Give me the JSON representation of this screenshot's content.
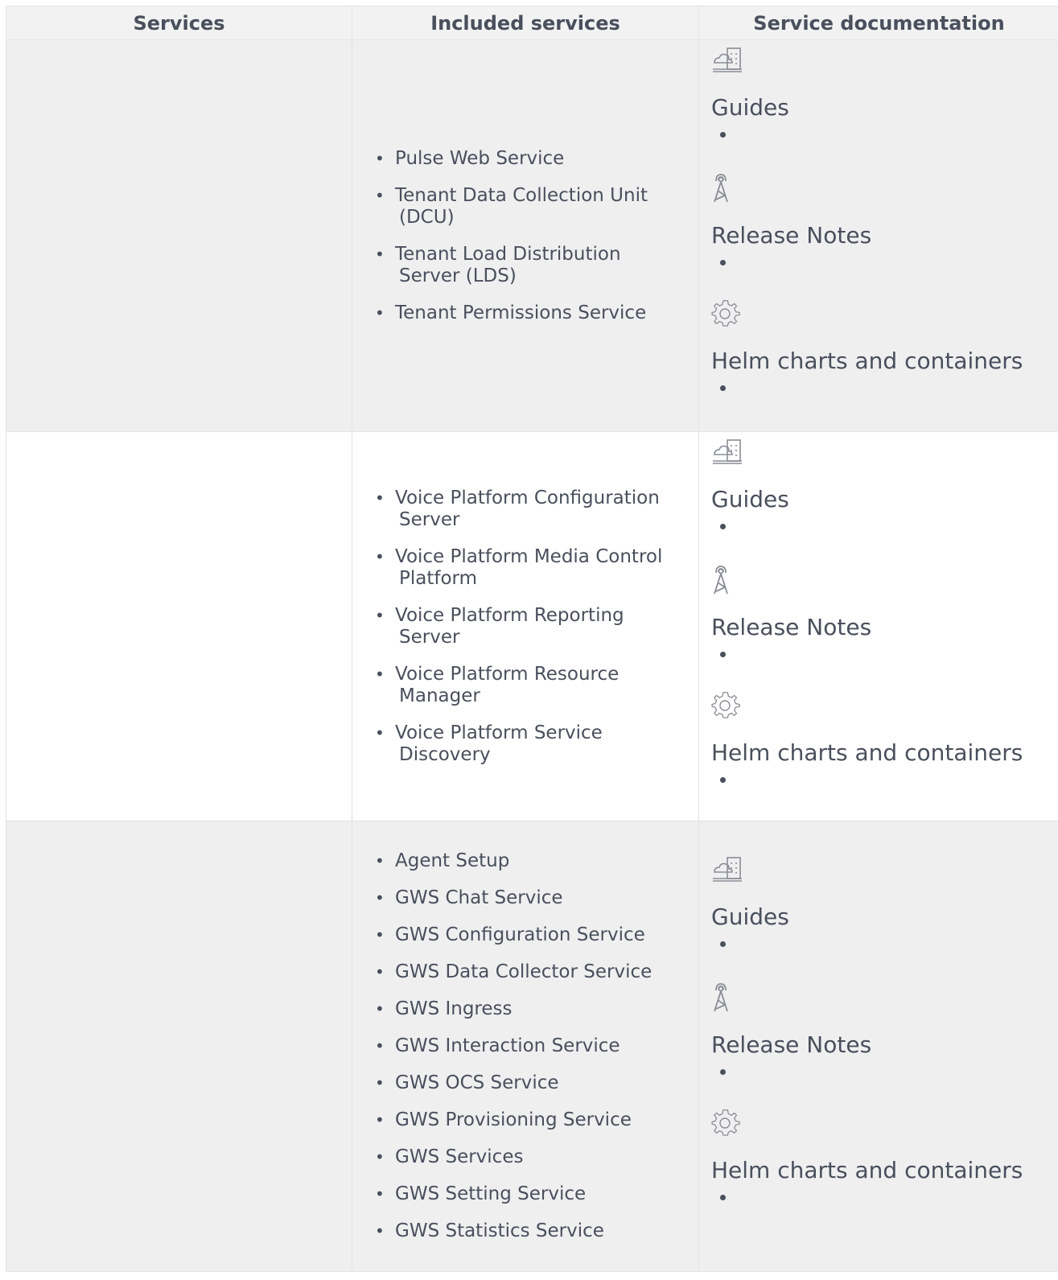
{
  "table": {
    "headers": [
      "Services",
      "Included services",
      "Service documentation"
    ],
    "rows": [
      {
        "services": "",
        "included": [
          "Pulse Web Service",
          "Tenant Data Collection Unit\n(DCU)",
          "Tenant Load Distribution\nServer (LDS)",
          "Tenant Permissions Service"
        ],
        "docs": [
          {
            "icon": "building-cloud-icon",
            "label": "Guides"
          },
          {
            "icon": "antenna-tower-icon",
            "label": "Release Notes"
          },
          {
            "icon": "gear-icon",
            "label": "Helm charts and containers"
          }
        ]
      },
      {
        "services": "",
        "included": [
          "Voice Platform Configuration\nServer",
          "Voice Platform Media Control\nPlatform",
          "Voice Platform Reporting\nServer",
          "Voice Platform Resource\nManager",
          "Voice Platform Service\nDiscovery"
        ],
        "docs": [
          {
            "icon": "building-cloud-icon",
            "label": "Guides"
          },
          {
            "icon": "antenna-tower-icon",
            "label": "Release Notes"
          },
          {
            "icon": "gear-icon",
            "label": "Helm charts and containers"
          }
        ]
      },
      {
        "services": "",
        "included": [
          "Agent Setup",
          "GWS Chat Service",
          "GWS Configuration Service",
          "GWS Data Collector Service",
          "GWS Ingress",
          "GWS Interaction Service",
          "GWS OCS Service",
          "GWS Provisioning Service",
          "GWS Services",
          "GWS Setting Service",
          "GWS Statistics Service"
        ],
        "docs": [
          {
            "icon": "building-cloud-icon",
            "label": "Guides"
          },
          {
            "icon": "antenna-tower-icon",
            "label": "Release Notes"
          },
          {
            "icon": "gear-icon",
            "label": "Helm charts and containers"
          }
        ]
      }
    ]
  },
  "colors": {
    "text": "#4a4f5c",
    "header_bg": "#f2f2f3",
    "shaded_row_bg": "#efeff0",
    "border": "#e3e3e6",
    "icon": "#8a8d94"
  }
}
